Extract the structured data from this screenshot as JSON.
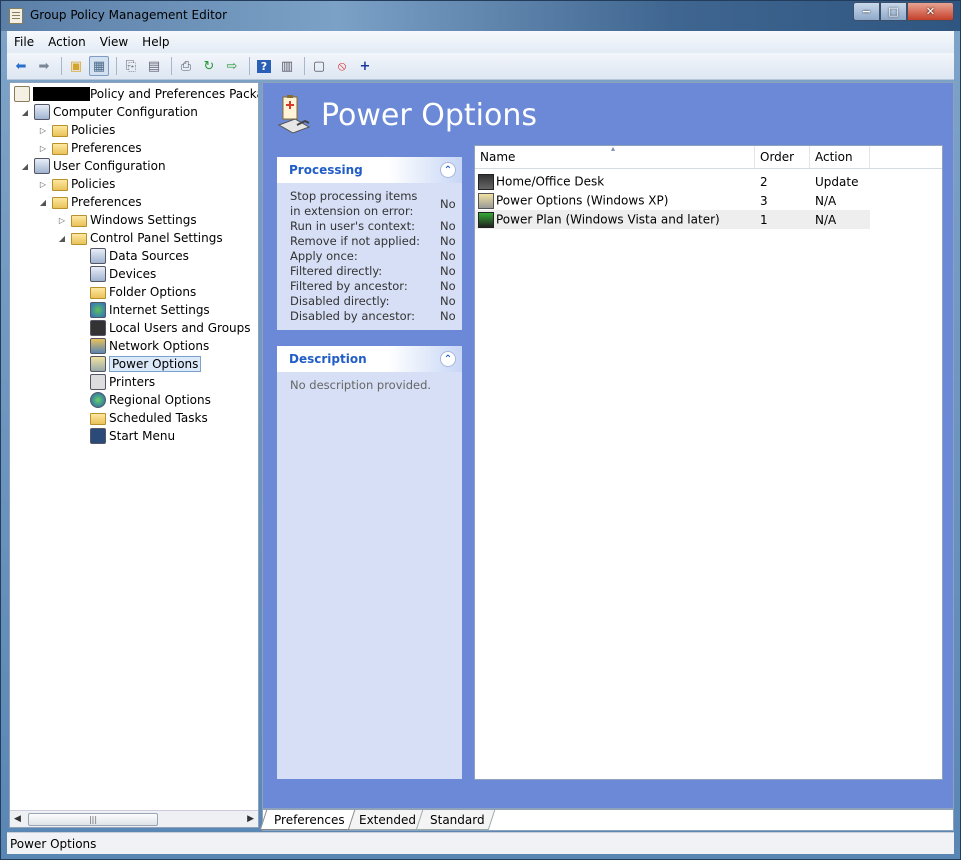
{
  "window": {
    "title": "Group Policy Management Editor"
  },
  "menu": [
    "File",
    "Action",
    "View",
    "Help"
  ],
  "toolbar": {
    "buttons": [
      "back-icon",
      "forward-icon",
      "up-folder-icon",
      "show-hide-tree-icon",
      "copy-icon",
      "paste-icon",
      "print-icon",
      "refresh-icon",
      "export-icon",
      "help-icon",
      "properties-icon",
      "view-icon",
      "stop-icon",
      "add-icon"
    ]
  },
  "tree": {
    "root": "Policy and Preferences Package [",
    "computer_config": "Computer Configuration",
    "cc_policies": "Policies",
    "cc_preferences": "Preferences",
    "user_config": "User Configuration",
    "uc_policies": "Policies",
    "uc_preferences": "Preferences",
    "windows_settings": "Windows Settings",
    "control_panel": "Control Panel Settings",
    "items": [
      "Data Sources",
      "Devices",
      "Folder Options",
      "Internet Settings",
      "Local Users and Groups",
      "Network Options",
      "Power Options",
      "Printers",
      "Regional Options",
      "Scheduled Tasks",
      "Start Menu"
    ],
    "selected": "Power Options"
  },
  "content": {
    "title": "Power Options",
    "processing": {
      "heading": "Processing",
      "rows": [
        {
          "label": "Stop processing items in extension on error:",
          "value": "No"
        },
        {
          "label": "Run in user's context:",
          "value": "No"
        },
        {
          "label": "Remove if not applied:",
          "value": "No"
        },
        {
          "label": "Apply once:",
          "value": "No"
        },
        {
          "label": "Filtered directly:",
          "value": "No"
        },
        {
          "label": "Filtered by ancestor:",
          "value": "No"
        },
        {
          "label": "Disabled directly:",
          "value": "No"
        },
        {
          "label": "Disabled by ancestor:",
          "value": "No"
        }
      ]
    },
    "description": {
      "heading": "Description",
      "text": "No description provided."
    },
    "list": {
      "columns": [
        "Name",
        "Order",
        "Action"
      ],
      "rows": [
        {
          "name": "Home/Office Desk",
          "order": "2",
          "action": "Update"
        },
        {
          "name": "Power Options (Windows XP)",
          "order": "3",
          "action": "N/A"
        },
        {
          "name": "Power Plan (Windows Vista and later)",
          "order": "1",
          "action": "N/A"
        }
      ]
    }
  },
  "tabs": [
    "Preferences",
    "Extended",
    "Standard"
  ],
  "status": "Power Options",
  "colors": {
    "content_bg": "#6b89d6",
    "panel_bg": "#d6dff5",
    "panel_head_text": "#215dc6"
  }
}
